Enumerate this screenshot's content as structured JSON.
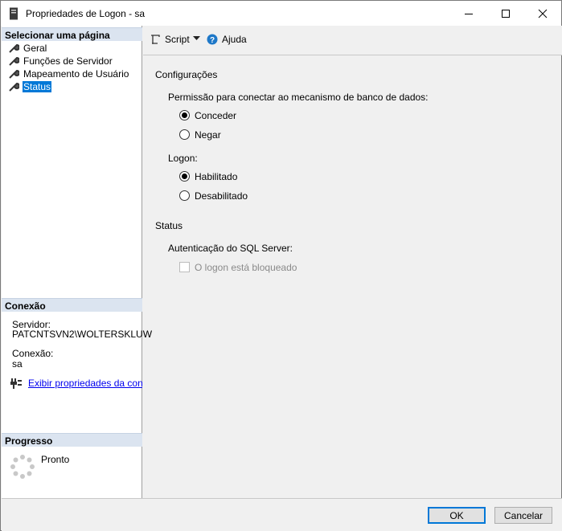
{
  "window": {
    "title": "Propriedades de Logon - sa"
  },
  "left": {
    "select_page_header": "Selecionar uma página",
    "pages": [
      {
        "label": "Geral"
      },
      {
        "label": "Funções de Servidor"
      },
      {
        "label": "Mapeamento de Usuário"
      },
      {
        "label": "Status",
        "selected": true
      }
    ],
    "connection_header": "Conexão",
    "server_label": "Servidor:",
    "server_value": "PATCNTSVN2\\WOLTERSKLUW",
    "connection_label": "Conexão:",
    "connection_value": "sa",
    "view_connection_link": "Exibir propriedades da conexã",
    "progress_header": "Progresso",
    "progress_status": "Pronto"
  },
  "toolbar": {
    "script_label": "Script",
    "help_label": "Ajuda"
  },
  "content": {
    "settings_title": "Configurações",
    "permission_label": "Permissão para conectar ao mecanismo de banco de dados:",
    "grant_label": "Conceder",
    "deny_label": "Negar",
    "permission_value": "Conceder",
    "logon_label": "Logon:",
    "enabled_label": "Habilitado",
    "disabled_label": "Desabilitado",
    "logon_value": "Habilitado",
    "status_title": "Status",
    "sql_auth_label": "Autenticação do SQL Server:",
    "locked_label": "O logon está bloqueado",
    "locked_checked": false
  },
  "footer": {
    "ok_label": "OK",
    "cancel_label": "Cancelar"
  },
  "colors": {
    "accent": "#0078d7",
    "header_bg": "#dbe4f0",
    "link": "#0000ee"
  }
}
